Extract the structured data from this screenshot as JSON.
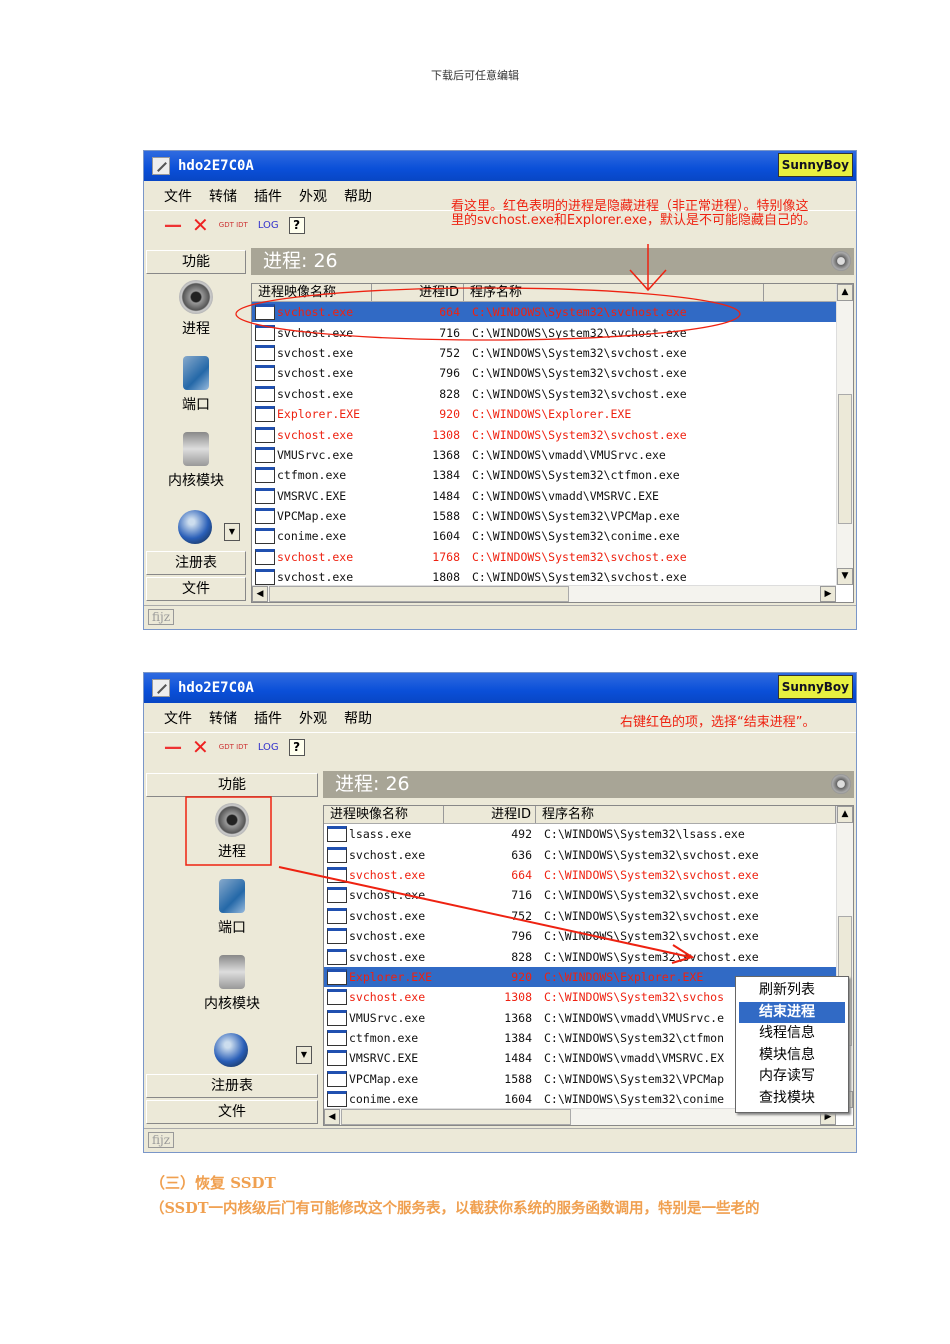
{
  "header_note": "下载后可任意编辑",
  "windows": [
    {
      "title": "hdo2E7C0A",
      "brand": "SunnyBoy",
      "menu": [
        "文件",
        "转储",
        "插件",
        "外观",
        "帮助"
      ],
      "toolbar": [
        "—",
        "✕",
        "GDT IDT",
        "LOG",
        "?"
      ],
      "side_header": "功能",
      "side_items": [
        "进程",
        "端口",
        "内核模块"
      ],
      "side_bottom": [
        "注册表",
        "文件"
      ],
      "panel_title": "进程: 26",
      "columns": [
        "进程映像名称",
        "进程ID",
        "程序名称"
      ],
      "rows": [
        {
          "name": "svchost.exe",
          "pid": "664",
          "path": "C:\\WINDOWS\\System32\\svchost.exe",
          "hidden": true,
          "selected": true
        },
        {
          "name": "svchost.exe",
          "pid": "716",
          "path": "C:\\WINDOWS\\System32\\svchost.exe"
        },
        {
          "name": "svchost.exe",
          "pid": "752",
          "path": "C:\\WINDOWS\\System32\\svchost.exe"
        },
        {
          "name": "svchost.exe",
          "pid": "796",
          "path": "C:\\WINDOWS\\System32\\svchost.exe"
        },
        {
          "name": "svchost.exe",
          "pid": "828",
          "path": "C:\\WINDOWS\\System32\\svchost.exe"
        },
        {
          "name": "Explorer.EXE",
          "pid": "920",
          "path": "C:\\WINDOWS\\Explorer.EXE",
          "hidden": true
        },
        {
          "name": "svchost.exe",
          "pid": "1308",
          "path": "C:\\WINDOWS\\System32\\svchost.exe",
          "hidden": true
        },
        {
          "name": "VMUSrvc.exe",
          "pid": "1368",
          "path": "C:\\WINDOWS\\vmadd\\VMUSrvc.exe"
        },
        {
          "name": "ctfmon.exe",
          "pid": "1384",
          "path": "C:\\WINDOWS\\System32\\ctfmon.exe"
        },
        {
          "name": "VMSRVC.EXE",
          "pid": "1484",
          "path": "C:\\WINDOWS\\vmadd\\VMSRVC.EXE"
        },
        {
          "name": "VPCMap.exe",
          "pid": "1588",
          "path": "C:\\WINDOWS\\System32\\VPCMap.exe"
        },
        {
          "name": "conime.exe",
          "pid": "1604",
          "path": "C:\\WINDOWS\\System32\\conime.exe"
        },
        {
          "name": "svchost.exe",
          "pid": "1768",
          "path": "C:\\WINDOWS\\System32\\svchost.exe",
          "hidden": true
        },
        {
          "name": "svchost.exe",
          "pid": "1808",
          "path": "C:\\WINDOWS\\System32\\svchost.exe"
        }
      ],
      "status": "fijz",
      "annotation": "看这里。红色表明的进程是隐藏进程（非正常进程）。特别像这里的svchost.exe和Explorer.exe，默认是不可能隐藏自己的。"
    },
    {
      "title": "hdo2E7C0A",
      "brand": "SunnyBoy",
      "menu": [
        "文件",
        "转储",
        "插件",
        "外观",
        "帮助"
      ],
      "toolbar": [
        "—",
        "✕",
        "GDT IDT",
        "LOG",
        "?"
      ],
      "side_header": "功能",
      "side_items": [
        "进程",
        "端口",
        "内核模块"
      ],
      "side_bottom": [
        "注册表",
        "文件"
      ],
      "panel_title": "进程: 26",
      "columns": [
        "进程映像名称",
        "进程ID",
        "程序名称"
      ],
      "rows": [
        {
          "name": "lsass.exe",
          "pid": "492",
          "path": "C:\\WINDOWS\\System32\\lsass.exe"
        },
        {
          "name": "svchost.exe",
          "pid": "636",
          "path": "C:\\WINDOWS\\System32\\svchost.exe"
        },
        {
          "name": "svchost.exe",
          "pid": "664",
          "path": "C:\\WINDOWS\\System32\\svchost.exe",
          "hidden": true
        },
        {
          "name": "svchost.exe",
          "pid": "716",
          "path": "C:\\WINDOWS\\System32\\svchost.exe"
        },
        {
          "name": "svchost.exe",
          "pid": "752",
          "path": "C:\\WINDOWS\\System32\\svchost.exe"
        },
        {
          "name": "svchost.exe",
          "pid": "796",
          "path": "C:\\WINDOWS\\System32\\svchost.exe"
        },
        {
          "name": "svchost.exe",
          "pid": "828",
          "path": "C:\\WINDOWS\\System32\\svchost.exe"
        },
        {
          "name": "Explorer.EXE",
          "pid": "920",
          "path": "C:\\WINDOWS\\Explorer.EXE",
          "hidden": true,
          "selected": true
        },
        {
          "name": "svchost.exe",
          "pid": "1308",
          "path": "C:\\WINDOWS\\System32\\svchos",
          "hidden": true
        },
        {
          "name": "VMUSrvc.exe",
          "pid": "1368",
          "path": "C:\\WINDOWS\\vmadd\\VMUSrvc.e"
        },
        {
          "name": "ctfmon.exe",
          "pid": "1384",
          "path": "C:\\WINDOWS\\System32\\ctfmon"
        },
        {
          "name": "VMSRVC.EXE",
          "pid": "1484",
          "path": "C:\\WINDOWS\\vmadd\\VMSRVC.EX"
        },
        {
          "name": "VPCMap.exe",
          "pid": "1588",
          "path": "C:\\WINDOWS\\System32\\VPCMap"
        },
        {
          "name": "conime.exe",
          "pid": "1604",
          "path": "C:\\WINDOWS\\System32\\conime"
        }
      ],
      "status": "fijz",
      "annotation": "右键红色的项，选择“结束进程”。",
      "context_menu": [
        "刷新列表",
        "结束进程",
        "线程信息",
        "模块信息",
        "内存读写",
        "查找模块"
      ],
      "context_highlight": 1
    }
  ],
  "section_title": "（三）恢复 SSDT",
  "section_text": "（SSDT一内核级后门有可能修改这个服务表，以截获你系统的服务函数调用，特别是一些老的"
}
